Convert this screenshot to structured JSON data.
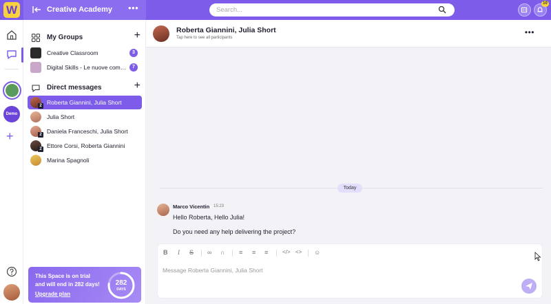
{
  "topbar": {
    "logo_letter": "W",
    "space_title": "Creative Academy",
    "more_glyph": "•••",
    "search_placeholder": "Search...",
    "notifications_count": "10"
  },
  "rail": {
    "demo_label": "Demo",
    "add_glyph": "+"
  },
  "sidebar": {
    "groups_title": "My Groups",
    "groups": [
      {
        "label": "Creative Classroom",
        "badge": "3"
      },
      {
        "label": "Digital Skills - Le nuove competenze",
        "badge": "7"
      }
    ],
    "dm_title": "Direct messages",
    "add_glyph": "+",
    "dms": [
      {
        "label": "Roberta Giannini, Julia Short",
        "count": "2",
        "active": true
      },
      {
        "label": "Julia Short",
        "count": ""
      },
      {
        "label": "Daniela Franceschi, Julia Short",
        "count": "2"
      },
      {
        "label": "Ettore Corsi, Roberta Giannini",
        "count": "2"
      },
      {
        "label": "Marina Spagnoli",
        "count": ""
      }
    ],
    "trial": {
      "text": "This Space is on trial and will end in 282 days!",
      "link": "Upgrade plan",
      "days_number": "282",
      "days_label": "DAYS",
      "progress_fraction": 0.77
    }
  },
  "chat": {
    "title": "Roberta Giannini, Julia Short",
    "subtitle": "Tap here to see all participants",
    "more_glyph": "•••",
    "day_label": "Today",
    "message": {
      "author": "Marco Vicentin",
      "time": "15:23",
      "line1": "Hello Roberta, Hello Julia!",
      "line2": "Do you need any help delivering the project?"
    },
    "composer": {
      "placeholder": "Message Roberta Giannini, Julia Short"
    }
  },
  "colors": {
    "accent": "#7c5ce8",
    "logo_bg": "#f7d23e"
  }
}
